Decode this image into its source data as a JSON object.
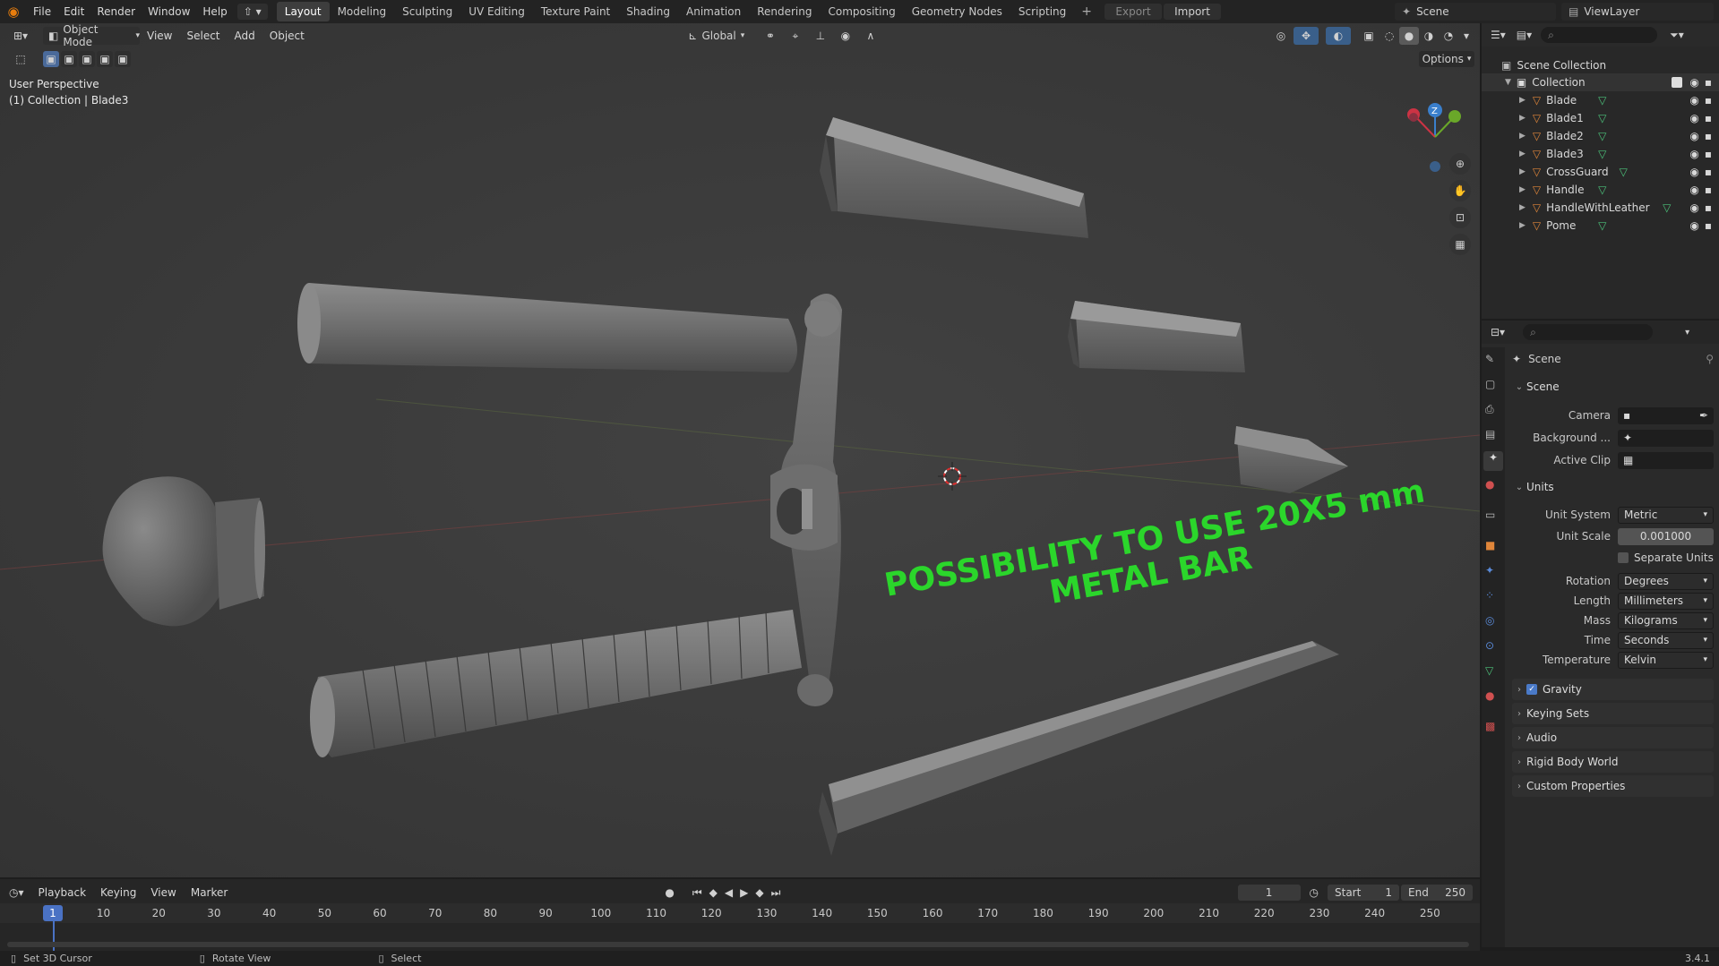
{
  "topbar": {
    "menus": [
      "File",
      "Edit",
      "Render",
      "Window",
      "Help"
    ],
    "workspaces": [
      "Layout",
      "Modeling",
      "Sculpting",
      "UV Editing",
      "Texture Paint",
      "Shading",
      "Animation",
      "Rendering",
      "Compositing",
      "Geometry Nodes",
      "Scripting"
    ],
    "active_workspace": "Layout",
    "export_label": "Export",
    "import_label": "Import",
    "scene_name": "Scene",
    "view_layer": "ViewLayer"
  },
  "viewport_header": {
    "mode": "Object Mode",
    "menus": [
      "View",
      "Select",
      "Add",
      "Object"
    ],
    "transform_orientation": "Global",
    "options_label": "Options"
  },
  "viewport": {
    "perspective_label": "User Perspective",
    "selection_label": "(1) Collection | Blade3",
    "overlay_text_line1": "POSSIBILITY TO USE 20X5 mm",
    "overlay_text_line2": "METAL BAR",
    "overlay_color": "#2bd62b",
    "gizmo_axis_z": "Z"
  },
  "outliner": {
    "root": "Scene Collection",
    "collection": "Collection",
    "items": [
      "Blade",
      "Blade1",
      "Blade2",
      "Blade3",
      "CrossGuard",
      "Handle",
      "HandleWithLeather",
      "Pome"
    ]
  },
  "properties": {
    "context_title": "Scene",
    "scene_section": "Scene",
    "camera_label": "Camera",
    "background_label": "Background ...",
    "active_clip_label": "Active Clip",
    "units_section": "Units",
    "unit_system_label": "Unit System",
    "unit_system_value": "Metric",
    "unit_scale_label": "Unit Scale",
    "unit_scale_value": "0.001000",
    "separate_units_label": "Separate Units",
    "rotation_label": "Rotation",
    "rotation_value": "Degrees",
    "length_label": "Length",
    "length_value": "Millimeters",
    "mass_label": "Mass",
    "mass_value": "Kilograms",
    "time_label": "Time",
    "time_value": "Seconds",
    "temperature_label": "Temperature",
    "temperature_value": "Kelvin",
    "gravity_label": "Gravity",
    "keying_sets_label": "Keying Sets",
    "audio_label": "Audio",
    "rigid_body_label": "Rigid Body World",
    "custom_props_label": "Custom Properties"
  },
  "timeline": {
    "menus": [
      "Playback",
      "Keying",
      "View",
      "Marker"
    ],
    "current_frame": "1",
    "start_label": "Start",
    "start_value": "1",
    "end_label": "End",
    "end_value": "250",
    "ticks": [
      "1",
      "10",
      "20",
      "30",
      "40",
      "50",
      "60",
      "70",
      "80",
      "90",
      "100",
      "110",
      "120",
      "130",
      "140",
      "150",
      "160",
      "170",
      "180",
      "190",
      "200",
      "210",
      "220",
      "230",
      "240",
      "250"
    ]
  },
  "statusbar": {
    "hint1": "Set 3D Cursor",
    "hint2": "Rotate View",
    "hint3": "Select",
    "version": "3.4.1"
  },
  "icons": [
    "blender-logo-icon",
    "eye-icon",
    "camera-icon",
    "mesh-icon",
    "triangle-object-icon",
    "zoom-icon",
    "hand-icon",
    "camera-view-icon",
    "grid-icon",
    "cursor-icon",
    "search-icon",
    "filter-icon",
    "play-icon"
  ]
}
